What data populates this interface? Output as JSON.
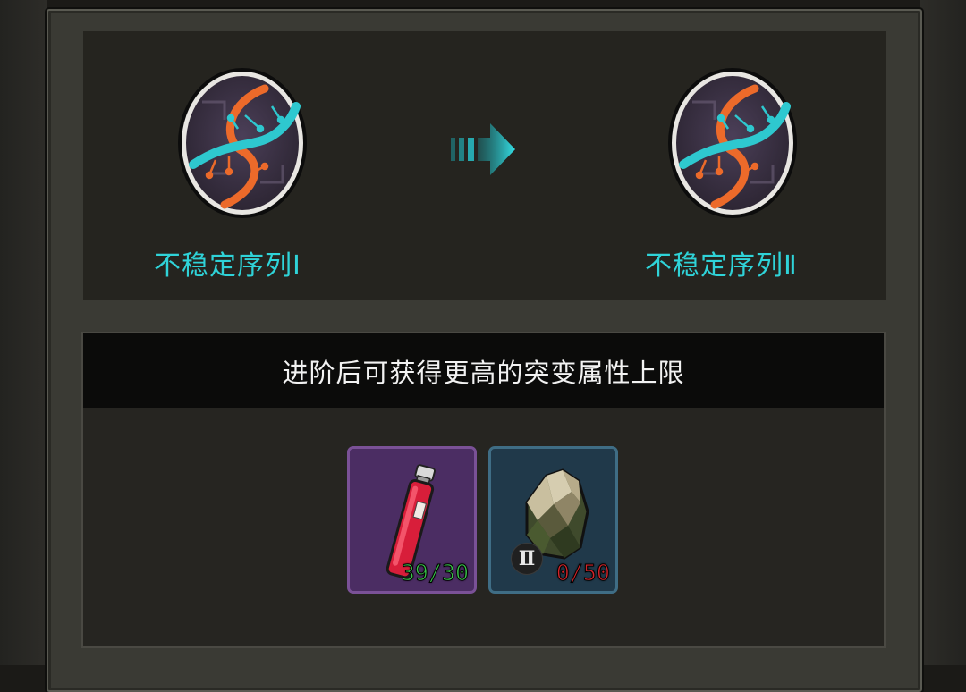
{
  "upgrade": {
    "from_name": "不稳定序列Ⅰ",
    "to_name": "不稳定序列Ⅱ",
    "from_icon": "dna-icon",
    "to_icon": "dna-icon",
    "arrow_icon": "arrow-right-icon"
  },
  "description": "进阶后可获得更高的突变属性上限",
  "materials": [
    {
      "icon": "serum-vial-icon",
      "count": "39/30",
      "status": "enough",
      "frame_color": "#7a5197"
    },
    {
      "icon": "ore-crystal-icon",
      "grade": "Ⅱ",
      "count": "0/50",
      "status": "insufficient",
      "frame_color": "#3f6d85"
    }
  ],
  "colors": {
    "accent": "#2fd3d8",
    "enough": "#39c44a",
    "insufficient": "#d2242a"
  }
}
